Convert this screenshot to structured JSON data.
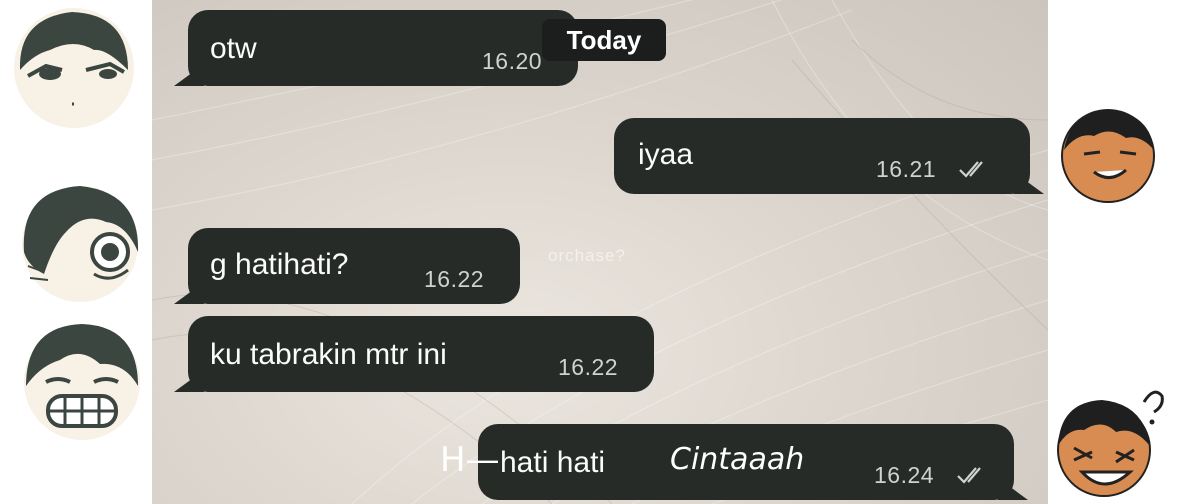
{
  "date_divider": "Today",
  "watermark": "orchase?",
  "messages": [
    {
      "text": "otw",
      "time": "16.20",
      "direction": "incoming"
    },
    {
      "text": "iyaa",
      "time": "16.21",
      "direction": "outgoing",
      "status": "read"
    },
    {
      "text": "g hatihati?",
      "time": "16.22",
      "direction": "incoming"
    },
    {
      "text": "ku tabrakin mtr ini",
      "time": "16.22",
      "direction": "incoming"
    },
    {
      "text": "hati hati",
      "time": "16.24",
      "direction": "outgoing",
      "status": "read"
    }
  ],
  "annotations": {
    "prefix": "H—",
    "suffix": "Cintaaah"
  },
  "colors": {
    "bubble": "#262b28",
    "skin_orange": "#d98c52",
    "skin_light": "#f7f1e6",
    "hair": "#3c4641"
  },
  "icons": [
    "double-check-icon",
    "avatar-incoming-1",
    "avatar-incoming-2",
    "avatar-incoming-3",
    "avatar-outgoing-1",
    "avatar-outgoing-2"
  ]
}
